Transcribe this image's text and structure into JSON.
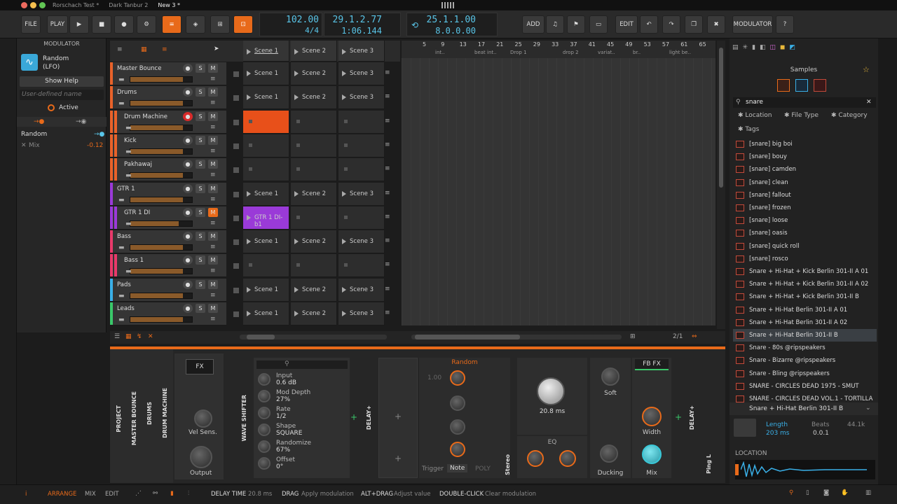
{
  "window": {
    "tabs": [
      "Rorschach Test *",
      "Dark Tanbur 2",
      "New 3 *"
    ]
  },
  "toolbar": {
    "file": "FILE",
    "play": "PLAY",
    "tempo": "102.00",
    "signature": "4/4",
    "position": "29.1.2.77",
    "time": "1:06.144",
    "loop_start": "25.1.1.00",
    "loop_len": "8.0.0.00",
    "add": "ADD",
    "edit": "EDIT",
    "modulator": "MODULATOR",
    "help": "?"
  },
  "modulator": {
    "header": "MODULATOR",
    "name": "Random",
    "type": "(LFO)",
    "show_help": "Show Help",
    "user_name_placeholder": "User-defined name",
    "active": "Active",
    "target": "Random",
    "mix_label": "Mix",
    "mix_value": "-0.12"
  },
  "scenes_header": [
    "Scene 1",
    "Scene 2",
    "Scene 3"
  ],
  "tracks": [
    {
      "name": "Master Bounce",
      "color": "#e8622a",
      "clips": [
        "Scene 1",
        "Scene 2",
        "Scene 3"
      ],
      "fader": 0.85,
      "sub": false
    },
    {
      "name": "Drums",
      "color": "#e8622a",
      "clips": [
        "Scene 1",
        "Scene 2",
        "Scene 3"
      ],
      "fader": 0.85,
      "sub": false
    },
    {
      "name": "Drum Machine",
      "color": "#e8622a",
      "clips": [
        "",
        "",
        ""
      ],
      "fader": 0.85,
      "sub": true,
      "rec": true
    },
    {
      "name": "Kick",
      "color": "#e8622a",
      "clips": [
        "",
        "",
        ""
      ],
      "fader": 0.85,
      "sub": true
    },
    {
      "name": "Pakhawaj",
      "color": "#e8622a",
      "clips": [
        "",
        "",
        ""
      ],
      "fader": 0.85,
      "sub": true
    },
    {
      "name": "GTR 1",
      "color": "#9a3ad8",
      "clips": [
        "Scene 1",
        "Scene 2",
        "Scene 3"
      ],
      "fader": 0.85,
      "sub": false
    },
    {
      "name": "GTR 1 DI",
      "color": "#9a3ad8",
      "clips": [
        "GTR 1 DI-b1",
        "",
        ""
      ],
      "fader": 0.78,
      "sub": true,
      "mon": true
    },
    {
      "name": "Bass",
      "color": "#e83a6a",
      "clips": [
        "Scene 1",
        "Scene 2",
        "Scene 3"
      ],
      "fader": 0.85,
      "sub": false
    },
    {
      "name": "Bass 1",
      "color": "#e83a6a",
      "clips": [
        "",
        "",
        ""
      ],
      "fader": 0.85,
      "sub": true
    },
    {
      "name": "Pads",
      "color": "#3ab0e8",
      "clips": [
        "Scene 1",
        "Scene 2",
        "Scene 3"
      ],
      "fader": 0.85,
      "sub": false
    },
    {
      "name": "Leads",
      "color": "#3ac86a",
      "clips": [
        "Scene 1",
        "Scene 2",
        "Scene 3"
      ],
      "fader": 0.85,
      "sub": false
    }
  ],
  "timeline": {
    "bars": [
      "5",
      "9",
      "13",
      "17",
      "21",
      "25",
      "29",
      "33",
      "37",
      "41",
      "45",
      "49",
      "53",
      "57",
      "61",
      "65"
    ],
    "markers": [
      "int..",
      "beat int..",
      "Drop 1",
      "drop 2",
      "variat..",
      "br..",
      "light be.."
    ],
    "zoom": "2/1"
  },
  "browser": {
    "title": "Samples",
    "search": "snare",
    "filters": [
      "Location",
      "File Type",
      "Category",
      "Tags"
    ],
    "results": [
      "[snare] big boi",
      "[snare] bouy",
      "[snare] camden",
      "[snare] clean",
      "[snare] fallout",
      "[snare] frozen",
      "[snare] loose",
      "[snare] oasis",
      "[snare] quick roll",
      "[snare] rosco",
      "Snare + Hi-Hat + Kick Berlin 301-II A 01",
      "Snare + Hi-Hat + Kick Berlin 301-II A 02",
      "Snare + Hi-Hat + Kick Berlin 301-II B",
      "Snare + Hi-Hat Berlin 301-II A 01",
      "Snare + Hi-Hat Berlin 301-II A 02",
      "Snare + Hi-Hat Berlin 301-II B",
      "Snare - 80s @ripspeakers",
      "Snare - Bizarre @ripspeakers",
      "Snare - Bling @ripspeakers",
      "SNARE - CIRCLES DEAD 1975 - SMUT",
      "SNARE - CIRCLES DEAD VOL.1 - TORTILLA"
    ],
    "selected": "Snare + Hi-Hat Berlin 301-II B",
    "length_label": "Length",
    "length_value": "203 ms",
    "beats_label": "Beats",
    "beats_value": "0.0.1",
    "rate": "44.1k",
    "location": "LOCATION"
  },
  "devices": {
    "sections": [
      "PROJECT",
      "MASTER BOUNCE",
      "DRUMS",
      "DRUM MACHINE"
    ],
    "fx": "FX",
    "vel_sens": "Vel Sens.",
    "output": "Output",
    "wave_shifter": "WAVE SHIFTER",
    "params": [
      {
        "name": "Input",
        "value": "0.6 dB"
      },
      {
        "name": "Mod Depth",
        "value": "27%"
      },
      {
        "name": "Rate",
        "value": "1/2"
      },
      {
        "name": "Shape",
        "value": "SQUARE"
      },
      {
        "name": "Randomize",
        "value": "67%"
      },
      {
        "name": "Offset",
        "value": "0°"
      }
    ],
    "delay": "DELAY+",
    "random": "Random",
    "random_val": "1.00",
    "trigger": "Trigger",
    "note": "Note",
    "poly": "POLY",
    "stereo": "Stereo",
    "delay_time": "20.8 ms",
    "eq": "EQ",
    "soft": "Soft",
    "ducking": "Ducking",
    "fbfx": "FB FX",
    "width": "Width",
    "mix": "Mix",
    "ping": "Ping L"
  },
  "statusbar": {
    "arrange": "ARRANGE",
    "mix": "MIX",
    "edit": "EDIT",
    "param": "DELAY TIME",
    "param_val": "20.8 ms",
    "drag": "DRAG",
    "drag_hint": "Apply modulation",
    "altdrag": "ALT+DRAG",
    "altdrag_hint": "Adjust value",
    "dbl": "DOUBLE-CLICK",
    "dbl_hint": "Clear modulation"
  }
}
